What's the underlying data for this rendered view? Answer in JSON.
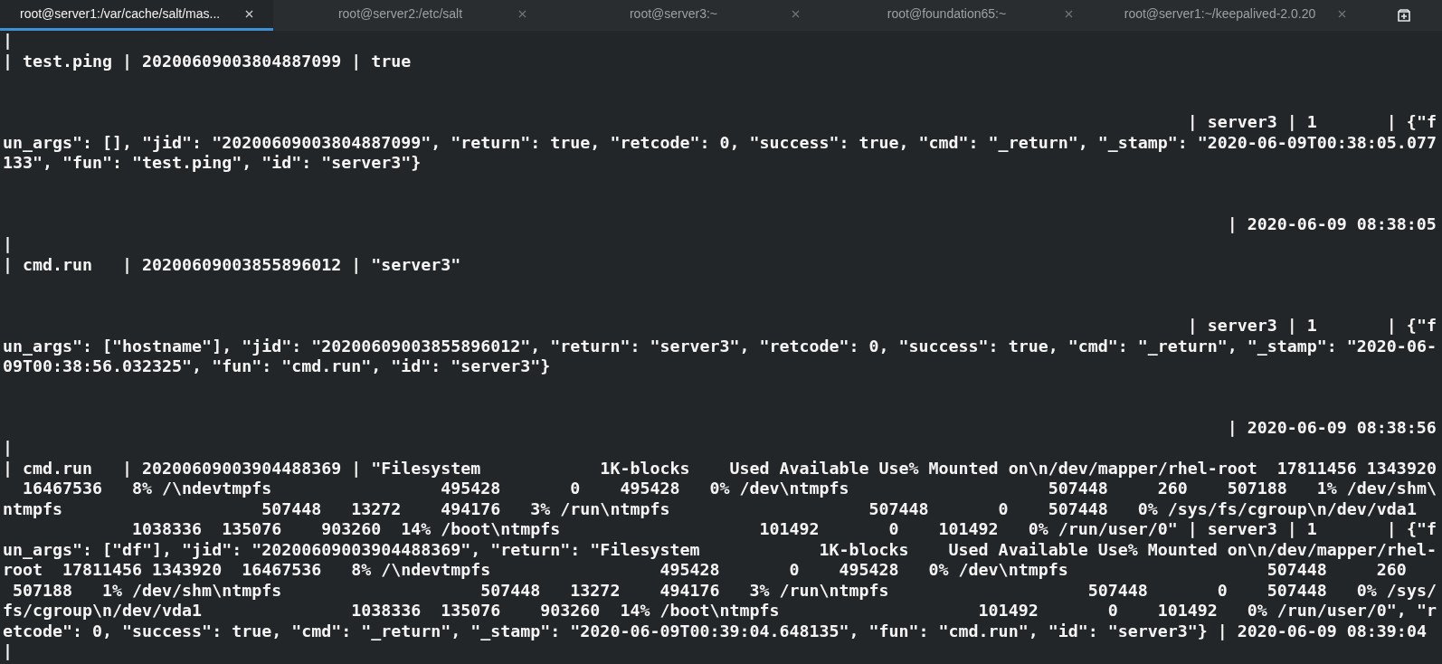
{
  "tabs": [
    {
      "label": "root@server1:/var/cache/salt/mas...",
      "selected": true
    },
    {
      "label": "root@server2:/etc/salt",
      "selected": false
    },
    {
      "label": "root@server3:~",
      "selected": false
    },
    {
      "label": "root@foundation65:~",
      "selected": false
    },
    {
      "label": "root@server1:~/keepalived-2.0.20",
      "selected": false
    }
  ],
  "terminal": {
    "lines": [
      {
        "kind": "text",
        "text": "|"
      },
      {
        "kind": "text",
        "text": "| test.ping | 20200609003804887099 | true"
      },
      {
        "kind": "blank"
      },
      {
        "kind": "blank"
      },
      {
        "kind": "right",
        "text": "| server3 | 1       | {\"f"
      },
      {
        "kind": "text",
        "text": "un_args\": [], \"jid\": \"20200609003804887099\", \"return\": true, \"retcode\": 0, \"success\": true, \"cmd\": \"_return\", \"_stamp\": \"2020-06-09T00:38:05.077"
      },
      {
        "kind": "text",
        "text": "133\", \"fun\": \"test.ping\", \"id\": \"server3\"}"
      },
      {
        "kind": "blank"
      },
      {
        "kind": "blank"
      },
      {
        "kind": "right",
        "text": "| 2020-06-09 08:38:05"
      },
      {
        "kind": "text",
        "text": "|"
      },
      {
        "kind": "text",
        "text": "| cmd.run   | 20200609003855896012 | \"server3\""
      },
      {
        "kind": "blank"
      },
      {
        "kind": "blank"
      },
      {
        "kind": "right",
        "text": "| server3 | 1       | {\"f"
      },
      {
        "kind": "text",
        "text": "un_args\": [\"hostname\"], \"jid\": \"20200609003855896012\", \"return\": \"server3\", \"retcode\": 0, \"success\": true, \"cmd\": \"_return\", \"_stamp\": \"2020-06-"
      },
      {
        "kind": "text",
        "text": "09T00:38:56.032325\", \"fun\": \"cmd.run\", \"id\": \"server3\"}"
      },
      {
        "kind": "blank"
      },
      {
        "kind": "blank"
      },
      {
        "kind": "right",
        "text": "| 2020-06-09 08:38:56"
      },
      {
        "kind": "text",
        "text": "|"
      },
      {
        "kind": "text",
        "text": "| cmd.run   | 20200609003904488369 | \"Filesystem            1K-blocks    Used Available Use% Mounted on\\n/dev/mapper/rhel-root  17811456 1343920"
      },
      {
        "kind": "text",
        "text": "  16467536   8% /\\ndevtmpfs                 495428       0    495428   0% /dev\\ntmpfs                    507448     260    507188   1% /dev/shm\\"
      },
      {
        "kind": "text",
        "text": "ntmpfs                    507448   13272    494176   3% /run\\ntmpfs                    507448       0    507448   0% /sys/fs/cgroup\\n/dev/vda1"
      },
      {
        "kind": "text",
        "text": "             1038336  135076    903260  14% /boot\\ntmpfs                    101492       0    101492   0% /run/user/0\" | server3 | 1       | {\"f"
      },
      {
        "kind": "text",
        "text": "un_args\": [\"df\"], \"jid\": \"20200609003904488369\", \"return\": \"Filesystem            1K-blocks    Used Available Use% Mounted on\\n/dev/mapper/rhel-"
      },
      {
        "kind": "text",
        "text": "root  17811456 1343920  16467536   8% /\\ndevtmpfs                 495428       0    495428   0% /dev\\ntmpfs                    507448     260"
      },
      {
        "kind": "text",
        "text": " 507188   1% /dev/shm\\ntmpfs                    507448   13272    494176   3% /run\\ntmpfs                    507448       0    507448   0% /sys/"
      },
      {
        "kind": "text",
        "text": "fs/cgroup\\n/dev/vda1               1038336  135076    903260  14% /boot\\ntmpfs                    101492       0    101492   0% /run/user/0\", \"r"
      },
      {
        "kind": "text",
        "text": "etcode\": 0, \"success\": true, \"cmd\": \"_return\", \"_stamp\": \"2020-06-09T00:39:04.648135\", \"fun\": \"cmd.run\", \"id\": \"server3\"} | 2020-06-09 08:39:04"
      },
      {
        "kind": "text",
        "text": "|"
      }
    ]
  }
}
